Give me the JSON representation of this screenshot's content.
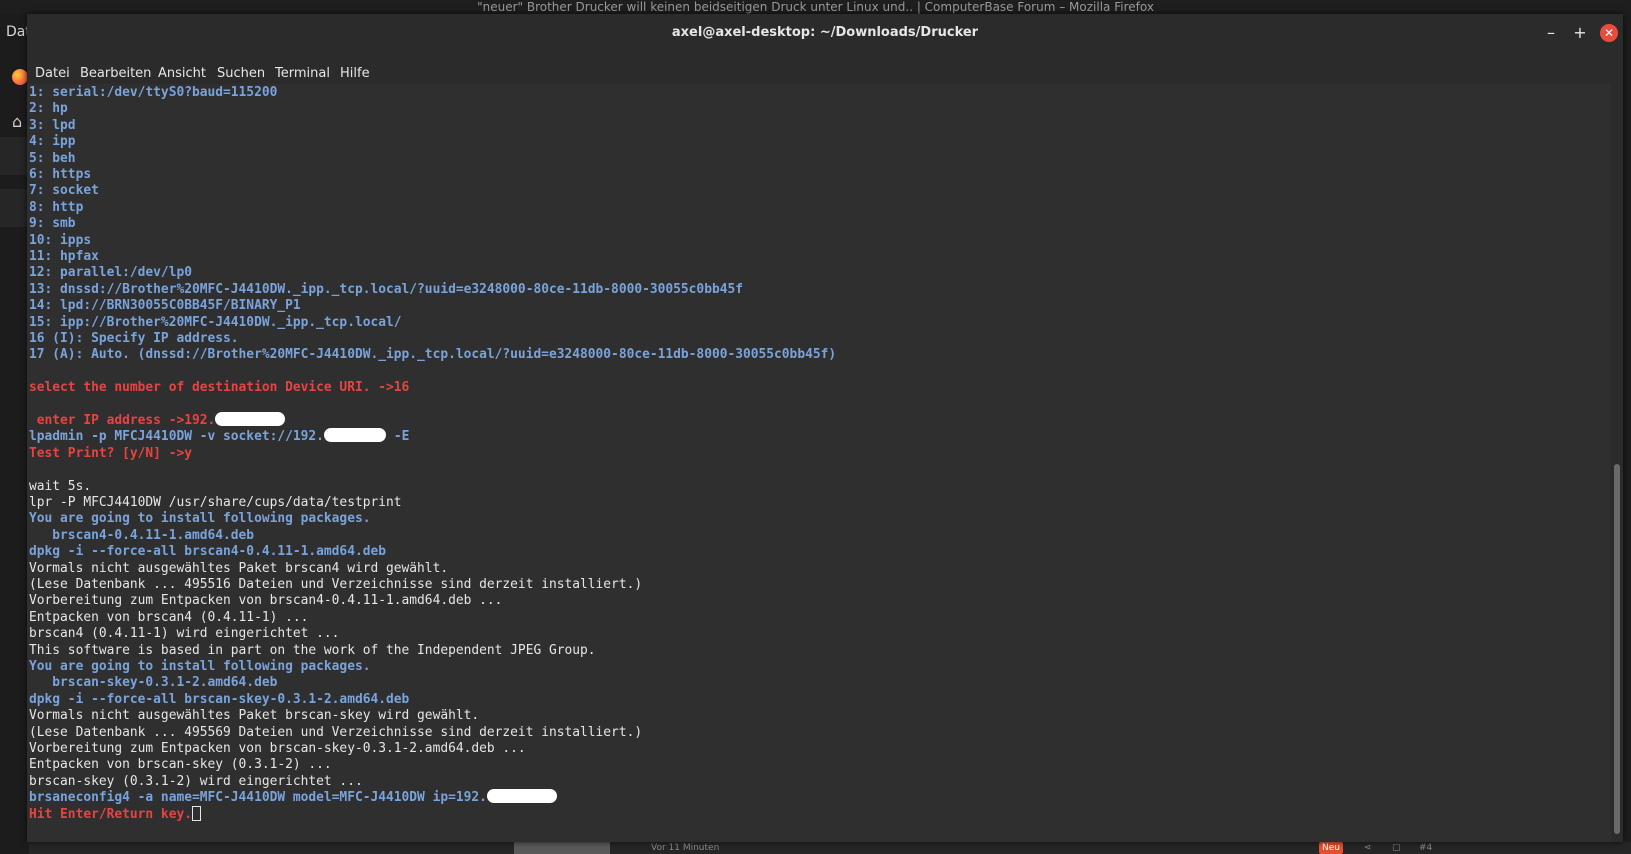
{
  "background": {
    "firefox_title": "\"neuer\" Brother Drucker will keinen beidseitigen Druck unter Linux und.. | ComputerBase Forum – Mozilla Firefox",
    "left_label": "Dat",
    "bottom_time": "Vor 11 Minuten",
    "bottom_badge": "Neu",
    "bottom_number": "#4"
  },
  "window": {
    "title": "axel@axel-desktop: ~/Downloads/Drucker",
    "minimize": "–",
    "maximize": "+",
    "close": "✕"
  },
  "menu": [
    "Datei",
    "Bearbeiten",
    "Ansicht",
    "Suchen",
    "Terminal",
    "Hilfe"
  ],
  "colors": {
    "blue": "#7aa3dc",
    "red": "#e84343",
    "white": "#e6e6e6",
    "background": "#2f2f2f"
  },
  "terminal": {
    "lines": [
      {
        "text": "1: serial:/dev/ttyS0?baud=115200",
        "color": "blue"
      },
      {
        "text": "2: hp",
        "color": "blue"
      },
      {
        "text": "3: lpd",
        "color": "blue"
      },
      {
        "text": "4: ipp",
        "color": "blue"
      },
      {
        "text": "5: beh",
        "color": "blue"
      },
      {
        "text": "6: https",
        "color": "blue"
      },
      {
        "text": "7: socket",
        "color": "blue"
      },
      {
        "text": "8: http",
        "color": "blue"
      },
      {
        "text": "9: smb",
        "color": "blue"
      },
      {
        "text": "10: ipps",
        "color": "blue"
      },
      {
        "text": "11: hpfax",
        "color": "blue"
      },
      {
        "text": "12: parallel:/dev/lp0",
        "color": "blue"
      },
      {
        "text": "13: dnssd://Brother%20MFC-J4410DW._ipp._tcp.local/?uuid=e3248000-80ce-11db-8000-30055c0bb45f",
        "color": "blue"
      },
      {
        "text": "14: lpd://BRN30055C0BB45F/BINARY_P1",
        "color": "blue"
      },
      {
        "text": "15: ipp://Brother%20MFC-J4410DW._ipp._tcp.local/",
        "color": "blue"
      },
      {
        "text": "16 (I): Specify IP address.",
        "color": "blue"
      },
      {
        "text": "17 (A): Auto. (dnssd://Brother%20MFC-J4410DW._ipp._tcp.local/?uuid=e3248000-80ce-11db-8000-30055c0bb45f)",
        "color": "blue"
      },
      {
        "text": "",
        "color": "white"
      },
      {
        "text": "select the number of destination Device URI. ->16",
        "color": "red"
      },
      {
        "text": "",
        "color": "white"
      },
      {
        "text": " enter IP address ->192.",
        "color": "red",
        "redact": 9
      },
      {
        "text": "lpadmin -p MFCJ4410DW -v socket://192.",
        "color": "blue",
        "redact": 8,
        "after": " -E"
      },
      {
        "text": "Test Print? [y/N] ->y",
        "color": "red"
      },
      {
        "text": "",
        "color": "white"
      },
      {
        "text": "wait 5s.",
        "color": "white"
      },
      {
        "text": "lpr -P MFCJ4410DW /usr/share/cups/data/testprint",
        "color": "white"
      },
      {
        "text": "You are going to install following packages.",
        "color": "blue"
      },
      {
        "text": "   brscan4-0.4.11-1.amd64.deb",
        "color": "blue"
      },
      {
        "text": "dpkg -i --force-all brscan4-0.4.11-1.amd64.deb",
        "color": "blue"
      },
      {
        "text": "Vormals nicht ausgewähltes Paket brscan4 wird gewählt.",
        "color": "white"
      },
      {
        "text": "(Lese Datenbank ... 495516 Dateien und Verzeichnisse sind derzeit installiert.)",
        "color": "white"
      },
      {
        "text": "Vorbereitung zum Entpacken von brscan4-0.4.11-1.amd64.deb ...",
        "color": "white"
      },
      {
        "text": "Entpacken von brscan4 (0.4.11-1) ...",
        "color": "white"
      },
      {
        "text": "brscan4 (0.4.11-1) wird eingerichtet ...",
        "color": "white"
      },
      {
        "text": "This software is based in part on the work of the Independent JPEG Group.",
        "color": "white"
      },
      {
        "text": "You are going to install following packages.",
        "color": "blue"
      },
      {
        "text": "   brscan-skey-0.3.1-2.amd64.deb",
        "color": "blue"
      },
      {
        "text": "dpkg -i --force-all brscan-skey-0.3.1-2.amd64.deb",
        "color": "blue"
      },
      {
        "text": "Vormals nicht ausgewähltes Paket brscan-skey wird gewählt.",
        "color": "white"
      },
      {
        "text": "(Lese Datenbank ... 495569 Dateien und Verzeichnisse sind derzeit installiert.)",
        "color": "white"
      },
      {
        "text": "Vorbereitung zum Entpacken von brscan-skey-0.3.1-2.amd64.deb ...",
        "color": "white"
      },
      {
        "text": "Entpacken von brscan-skey (0.3.1-2) ...",
        "color": "white"
      },
      {
        "text": "brscan-skey (0.3.1-2) wird eingerichtet ...",
        "color": "white"
      },
      {
        "text": "brsaneconfig4 -a name=MFC-J4410DW model=MFC-J4410DW ip=192.",
        "color": "blue",
        "redact": 9
      },
      {
        "text": "Hit Enter/Return key.",
        "color": "red",
        "cursor": true
      }
    ]
  }
}
